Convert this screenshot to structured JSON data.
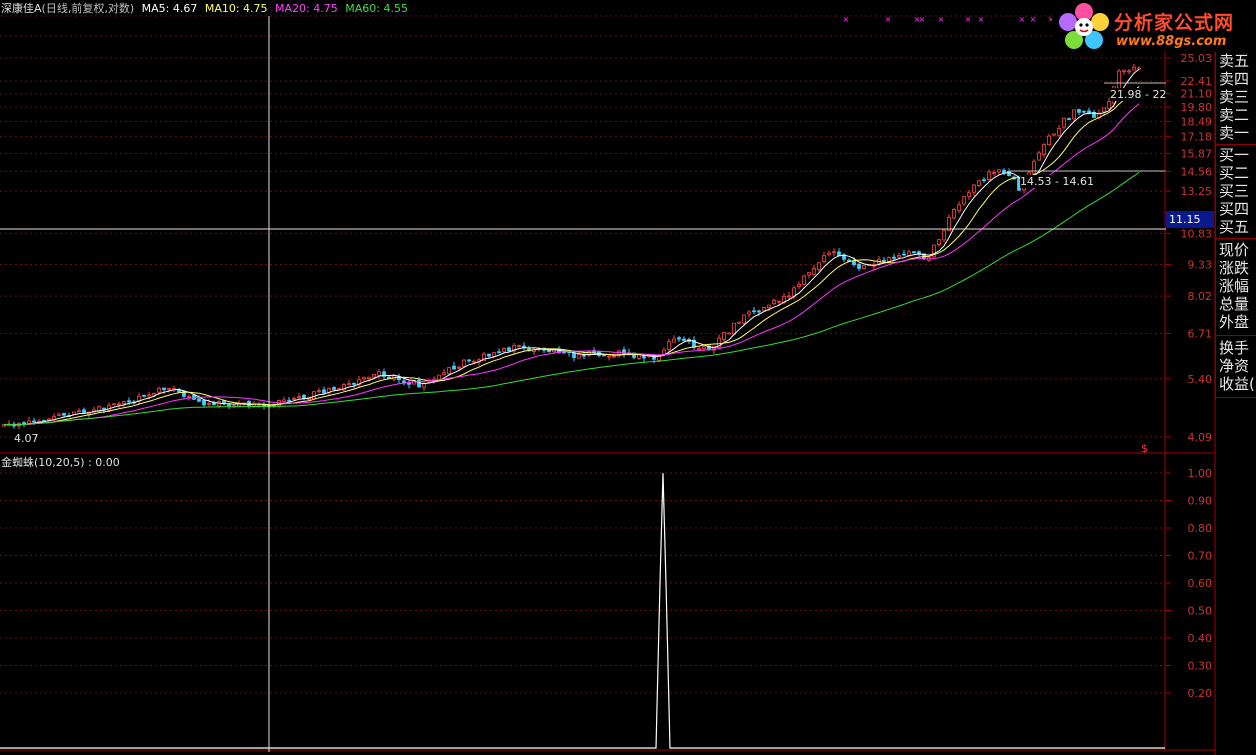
{
  "header": {
    "title": "深康佳A",
    "period": "(日线,前复权,对数)",
    "ma5_label": "MA5: 4.67",
    "ma10_label": "MA10: 4.75",
    "ma20_label": "MA20: 4.75",
    "ma60_label": "MA60: 4.55"
  },
  "colors": {
    "ma5": "#ffffff",
    "ma10": "#ffff66",
    "ma20": "#ff33ff",
    "ma60": "#33dd33",
    "up": "#ff4444",
    "down": "#44ccff",
    "axis": "#aa0000",
    "grid": "#661111"
  },
  "price_axis": {
    "ticks": [
      "25.03",
      "22.41",
      "21.10",
      "19.80",
      "18.49",
      "17.18",
      "15.87",
      "14.56",
      "13.25",
      "10.83",
      "9.33",
      "8.02",
      "6.71",
      "5.40",
      "4.09"
    ],
    "current_price": "11.15",
    "low_label": "4.07",
    "range_labels": [
      "21.98 - 22",
      "14.53 - 14.61"
    ],
    "dollar_marker": "$"
  },
  "indicator": {
    "title": "金蜘蛛(10,20,5) : 0.00",
    "ticks": [
      "1.00",
      "0.90",
      "0.80",
      "0.70",
      "0.60",
      "0.50",
      "0.40",
      "0.30",
      "0.20"
    ]
  },
  "side_panel": {
    "items": [
      "卖五",
      "卖四",
      "卖三",
      "卖二",
      "卖一",
      "买一",
      "买二",
      "买三",
      "买四",
      "买五",
      "现价",
      "涨跌",
      "涨幅",
      "总量",
      "外盘",
      "换手",
      "净资",
      "收益("
    ]
  },
  "logo": {
    "title": "分析家公式网",
    "url": "www.88gs.com"
  },
  "chart_data": {
    "type": "candlestick",
    "scale": "log",
    "ylim": [
      4.09,
      25.03
    ],
    "candles_summary": "daily candlesticks rising from about 4.07 to about 25",
    "ma_series": [
      {
        "name": "MA5",
        "value": 4.67
      },
      {
        "name": "MA10",
        "value": 4.75
      },
      {
        "name": "MA20",
        "value": 4.75
      },
      {
        "name": "MA60",
        "value": 4.55
      }
    ],
    "indicator_series": {
      "name": "金蜘蛛(10,20,5)",
      "ylim": [
        0,
        1.0
      ],
      "spike_value": 1.0
    }
  }
}
